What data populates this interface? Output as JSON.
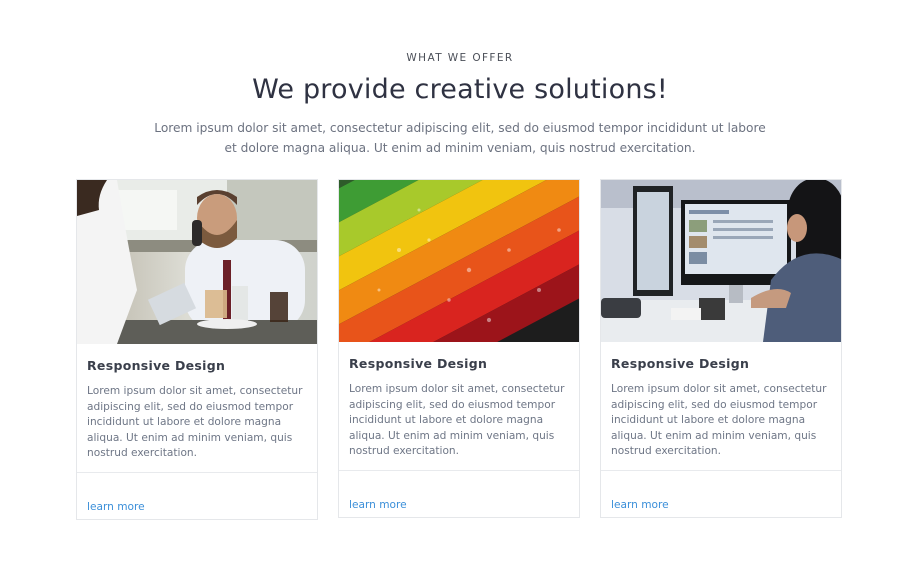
{
  "section": {
    "eyebrow": "WHAT WE OFFER",
    "headline": "We provide creative solutions!",
    "lead": "Lorem ipsum dolor sit amet, consectetur adipiscing elit, sed do eiusmod tempor incididunt ut labore et dolore magna aliqua. Ut enim ad minim veniam, quis nostrud exercitation."
  },
  "cards": [
    {
      "image": "business-man-on-phone-photo",
      "title": "Responsive Design",
      "text": "Lorem ipsum dolor sit amet, consectetur adipiscing elit, sed do eiusmod tempor incididunt ut labore et dolore magna aliqua. Ut enim ad minim veniam, quis nostrud exercitation.",
      "link": "learn more"
    },
    {
      "image": "colored-pencils-photo",
      "title": "Responsive Design",
      "text": "Lorem ipsum dolor sit amet, consectetur adipiscing elit, sed do eiusmod tempor incididunt ut labore et dolore magna aliqua. Ut enim ad minim veniam, quis nostrud exercitation.",
      "link": "learn more"
    },
    {
      "image": "woman-at-computer-photo",
      "title": "Responsive Design",
      "text": "Lorem ipsum dolor sit amet, consectetur adipiscing elit, sed do eiusmod tempor incididunt ut labore et dolore magna aliqua. Ut enim ad minim veniam, quis nostrud exercitation.",
      "link": "learn more"
    }
  ],
  "colors": {
    "heading": "#2f3242",
    "body_text": "#6e7686",
    "link": "#3b8fd9",
    "border": "#e5e7ea"
  }
}
